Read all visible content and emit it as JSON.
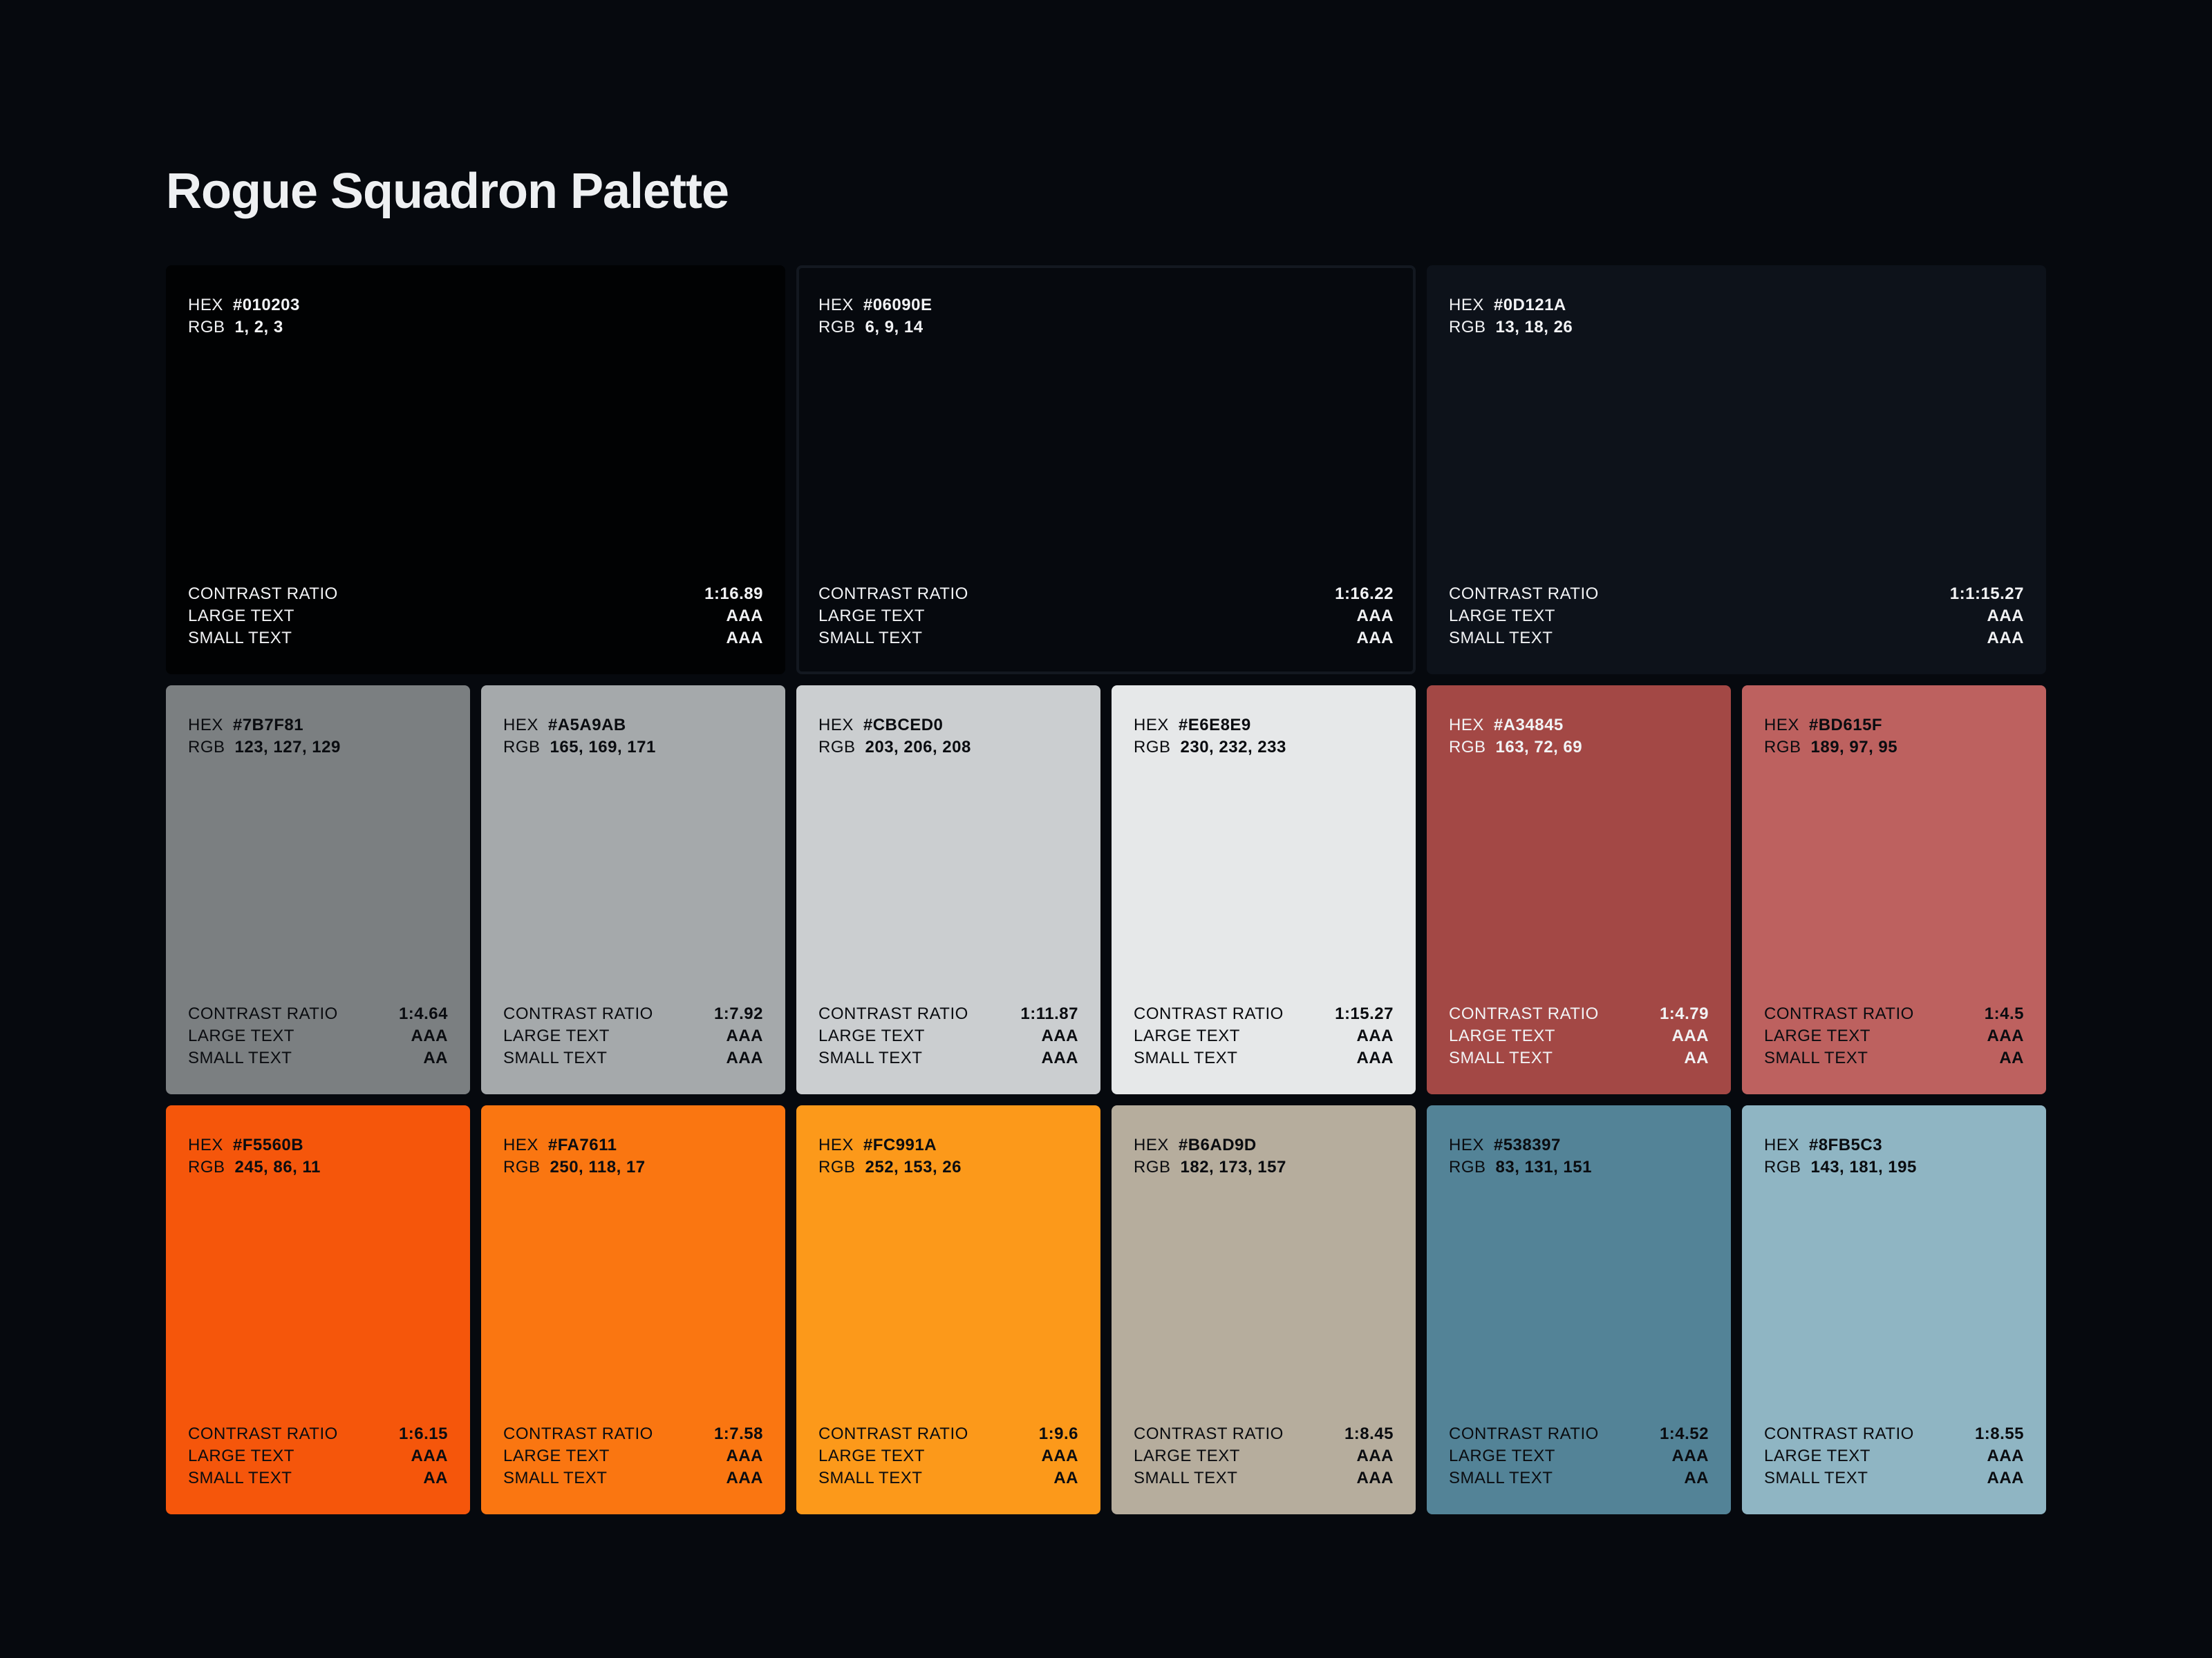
{
  "title": "Rogue Squadron Palette",
  "labels": {
    "hex": "HEX",
    "rgb": "RGB",
    "contrast": "CONTRAST RATIO",
    "large": "LARGE TEXT",
    "small": "SMALL TEXT"
  },
  "swatches": [
    {
      "hex": "#010203",
      "rgb": "1, 2, 3",
      "contrast": "1:16.89",
      "large": "AAA",
      "small": "AAA",
      "bg": "#010203",
      "text": "light"
    },
    {
      "hex": "#06090E",
      "rgb": "6, 9, 14",
      "contrast": "1:16.22",
      "large": "AAA",
      "small": "AAA",
      "bg": "#06090E",
      "text": "light"
    },
    {
      "hex": "#0D121A",
      "rgb": "13, 18, 26",
      "contrast": "1:1:15.27",
      "large": "AAA",
      "small": "AAA",
      "bg": "#0D121A",
      "text": "light"
    },
    {
      "hex": "#7B7F81",
      "rgb": "123, 127, 129",
      "contrast": "1:4.64",
      "large": "AAA",
      "small": "AA",
      "bg": "#7B7F81",
      "text": "dark"
    },
    {
      "hex": "#A5A9AB",
      "rgb": "165, 169, 171",
      "contrast": "1:7.92",
      "large": "AAA",
      "small": "AAA",
      "bg": "#A5A9AB",
      "text": "dark"
    },
    {
      "hex": "#CBCED0",
      "rgb": "203, 206, 208",
      "contrast": "1:11.87",
      "large": "AAA",
      "small": "AAA",
      "bg": "#CBCED0",
      "text": "dark"
    },
    {
      "hex": "#E6E8E9",
      "rgb": "230, 232, 233",
      "contrast": "1:15.27",
      "large": "AAA",
      "small": "AAA",
      "bg": "#E6E8E9",
      "text": "dark"
    },
    {
      "hex": "#A34845",
      "rgb": "163, 72, 69",
      "contrast": "1:4.79",
      "large": "AAA",
      "small": "AA",
      "bg": "#A34845",
      "text": "light"
    },
    {
      "hex": "#BD615F",
      "rgb": "189, 97, 95",
      "contrast": "1:4.5",
      "large": "AAA",
      "small": "AA",
      "bg": "#BD615F",
      "text": "dark"
    },
    {
      "hex": "#F5560B",
      "rgb": "245, 86, 11",
      "contrast": "1:6.15",
      "large": "AAA",
      "small": "AA",
      "bg": "#F5560B",
      "text": "dark"
    },
    {
      "hex": "#FA7611",
      "rgb": "250, 118, 17",
      "contrast": "1:7.58",
      "large": "AAA",
      "small": "AAA",
      "bg": "#FA7611",
      "text": "dark"
    },
    {
      "hex": "#FC991A",
      "rgb": "252, 153, 26",
      "contrast": "1:9.6",
      "large": "AAA",
      "small": "AA",
      "bg": "#FC991A",
      "text": "dark"
    },
    {
      "hex": "#B6AD9D",
      "rgb": "182, 173, 157",
      "contrast": "1:8.45",
      "large": "AAA",
      "small": "AAA",
      "bg": "#B6AD9D",
      "text": "dark"
    },
    {
      "hex": "#538397",
      "rgb": "83, 131, 151",
      "contrast": "1:4.52",
      "large": "AAA",
      "small": "AA",
      "bg": "#538397",
      "text": "dark"
    },
    {
      "hex": "#8FB5C3",
      "rgb": "143, 181, 195",
      "contrast": "1:8.55",
      "large": "AAA",
      "small": "AAA",
      "bg": "#8FB5C3",
      "text": "dark"
    }
  ]
}
